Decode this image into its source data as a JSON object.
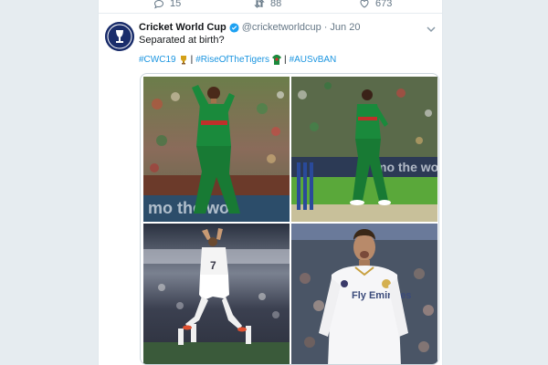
{
  "actions": {
    "replies": "15",
    "retweets": "88",
    "likes": "673"
  },
  "tweet": {
    "account_name": "Cricket World Cup",
    "handle": "@cricketworldcup",
    "separator": "·",
    "date": "Jun 20",
    "text": "Separated at birth?",
    "hashtags": [
      "#CWC19",
      "#RiseOfTheTigers",
      "#AUSvBAN"
    ],
    "hashtag_separator": "|"
  },
  "media": {
    "banner_text": "mo the wor",
    "cr7_number": "7",
    "cr7_sponsor": "Fly Emirates"
  },
  "colors": {
    "link": "#1b95e0",
    "muted": "#657786",
    "bangladesh_green": "#1a8a3c",
    "pitch": "#5aa83a"
  }
}
